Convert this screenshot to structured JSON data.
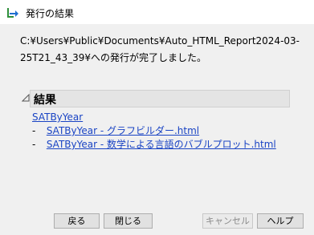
{
  "window": {
    "title": "発行の結果"
  },
  "message": {
    "line1": "C:¥Users¥Public¥Documents¥Auto_HTML_Report2024-03-",
    "line2": "25T21_43_39¥への発行が完了しました。"
  },
  "results": {
    "header": "結果",
    "main_link": "SATByYear",
    "items": [
      {
        "bullet": "-",
        "label": "SATByYear - グラフビルダー.html"
      },
      {
        "bullet": "-",
        "label": "SATByYear - 数学による言語のバブルプロット.html"
      }
    ]
  },
  "buttons": {
    "back": "戻る",
    "close": "閉じる",
    "cancel": "キャンセル",
    "help": "ヘルプ"
  },
  "colors": {
    "link": "#1a44c4",
    "header_bg": "#e4e4e4",
    "dialog_bg": "#f0f0f0"
  }
}
